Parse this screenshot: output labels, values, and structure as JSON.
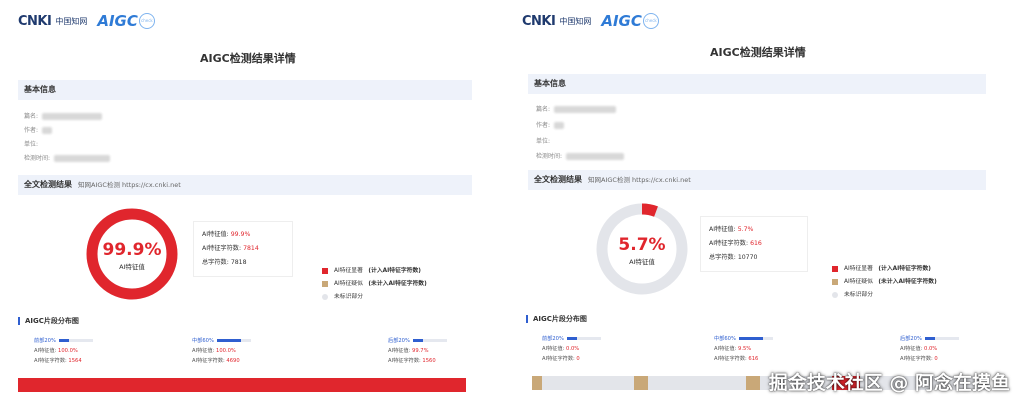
{
  "colors": {
    "ai": "#e0262d",
    "suspect": "#c9a878",
    "none": "#e3e5ea",
    "accent": "#2f5fd0"
  },
  "brand": {
    "logo": "CNKI",
    "logo_cn": "中国知网",
    "logo_sub": "www.cnki.net",
    "aigc": "AIGC",
    "aigc_sub": "check"
  },
  "reports": [
    {
      "title": "AIGC检测结果详情",
      "basic_info_header": "基本信息",
      "fields": {
        "name": "篇名:",
        "author": "作者:",
        "unit": "单位:",
        "time": "检测时间:"
      },
      "full_header": "全文检测结果",
      "full_source": "知网AIGC检测  https://cx.cnki.net",
      "ai_ratio": 99.9,
      "pct_label": "99.9%",
      "pct_sub": "AI特征值",
      "stats": {
        "ai_value_label": "AI特征值:",
        "ai_value": "99.9%",
        "ai_chars_label": "AI特征字符数:",
        "ai_chars": "7814",
        "total_label": "总字符数:",
        "total": "7818"
      },
      "legend": [
        {
          "name": "AI特征显著",
          "note": "(计入AI特征字符数)"
        },
        {
          "name": "AI特征疑似",
          "note": "(未计入AI特征字符数)"
        },
        {
          "name": "未标识部分",
          "note": ""
        }
      ],
      "dist_header": "AIGC片段分布图",
      "segments": [
        {
          "head": "前部20%",
          "fill": 0.3,
          "ai_label": "AI特征值:",
          "ai": "100.0%",
          "chars_label": "AI特征字符数:",
          "chars": "1564"
        },
        {
          "head": "中部60%",
          "fill": 0.7,
          "ai_label": "AI特征值:",
          "ai": "100.0%",
          "chars_label": "AI特征字符数:",
          "chars": "4690"
        },
        {
          "head": "后部20%",
          "fill": 0.3,
          "ai_label": "AI特征值:",
          "ai": "99.7%",
          "chars_label": "AI特征字符数:",
          "chars": "1560"
        }
      ]
    },
    {
      "title": "AIGC检测结果详情",
      "basic_info_header": "基本信息",
      "fields": {
        "name": "篇名:",
        "author": "作者:",
        "unit": "单位:",
        "time": "检测时间:"
      },
      "full_header": "全文检测结果",
      "full_source": "知网AIGC检测  https://cx.cnki.net",
      "ai_ratio": 5.7,
      "pct_label": "5.7%",
      "pct_sub": "AI特征值",
      "stats": {
        "ai_value_label": "AI特征值:",
        "ai_value": "5.7%",
        "ai_chars_label": "AI特征字符数:",
        "ai_chars": "616",
        "total_label": "总字符数:",
        "total": "10770"
      },
      "legend": [
        {
          "name": "AI特征显著",
          "note": "(计入AI特征字符数)"
        },
        {
          "name": "AI特征疑似",
          "note": "(未计入AI特征字符数)"
        },
        {
          "name": "未标识部分",
          "note": ""
        }
      ],
      "dist_header": "AIGC片段分布图",
      "segments": [
        {
          "head": "前部20%",
          "fill": 0.3,
          "ai_label": "AI特征值:",
          "ai": "0.0%",
          "chars_label": "AI特征字符数:",
          "chars": "0"
        },
        {
          "head": "中部60%",
          "fill": 0.7,
          "ai_label": "AI特征值:",
          "ai": "9.5%",
          "chars_label": "AI特征字符数:",
          "chars": "616"
        },
        {
          "head": "后部20%",
          "fill": 0.3,
          "ai_label": "AI特征值:",
          "ai": "0.0%",
          "chars_label": "AI特征字符数:",
          "chars": "0"
        }
      ]
    }
  ],
  "watermark": "掘金技术社区 @ 阿念在摸鱼"
}
